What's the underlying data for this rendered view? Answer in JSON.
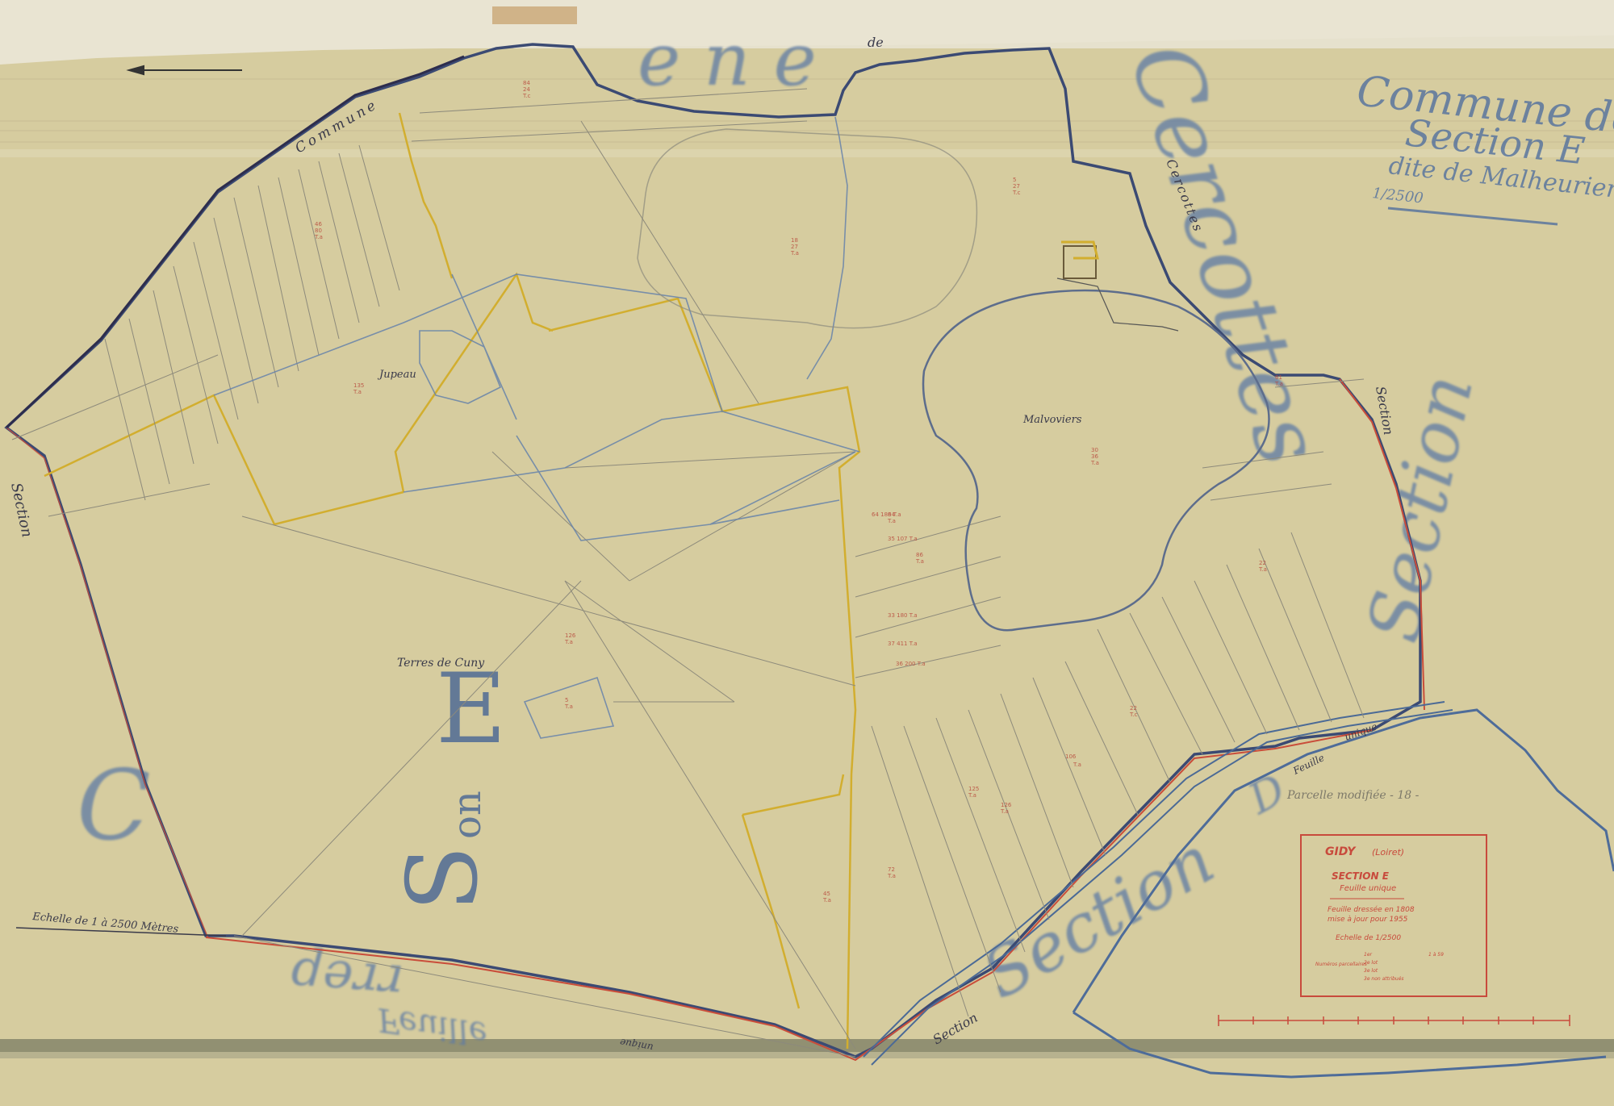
{
  "colors": {
    "paper": "#d6cc9f",
    "paper_edge": "#e9e4d2",
    "ink_blue": "#4f6f9a",
    "ink_dark": "#3a3a5c",
    "ink_red": "#c84a3c",
    "ink_yellow": "#d4b030",
    "pencil": "#8e8b7c"
  },
  "labels": {
    "commune_top": "Commune",
    "de_top": "de",
    "cercottes": "Cercottes",
    "section_left": "Section",
    "section_right": "Section",
    "section_bottom": "Section",
    "unique_bottom": "unique",
    "unique_right": "unique",
    "feuille_right": "Feuille",
    "jupeau": "Jupeau",
    "malvoviers": "Malvoviers",
    "terres_de_cuny": "Terres de Cuny",
    "big_E": "E",
    "big_S": "S",
    "big_S_on": "on",
    "stamp_C": "C",
    "stamp_Section_right": "Section",
    "stamp_Section_bottom": "Section",
    "stamp_D": "D",
    "stamp_Feuille_bottom": "Feuille",
    "stamp_bottom_mirror": "dəɹɹ",
    "stamp_top_ene": "e n e",
    "stamp_cercottes_big": "Cercottes",
    "echelle_left": "Echelle de 1 à 2500 Mètres",
    "parcelle_modifiee": "Parcelle modifiée - 18 -"
  },
  "title_stamp": {
    "line1": "Commune de Gidy",
    "line2": "Section E",
    "line3": "dite de Malheurier",
    "line4": "1/2500"
  },
  "cartouche": {
    "commune": "GIDY",
    "departement": "(Loiret)",
    "section": "SECTION E",
    "feuille": "Feuille unique",
    "dressee": "Feuille dressée en 1808",
    "mise_a_jour": "mise à jour pour 1955",
    "echelle": "Echelle de 1/2500",
    "numeros_label": "Numéros parcellaires",
    "num_row1_label": "1er",
    "num_row1_value": "1 à 59",
    "num_row2_label": "2e lot",
    "num_row3_label": "3e lot",
    "num_row4_label": "3e non attribués"
  }
}
